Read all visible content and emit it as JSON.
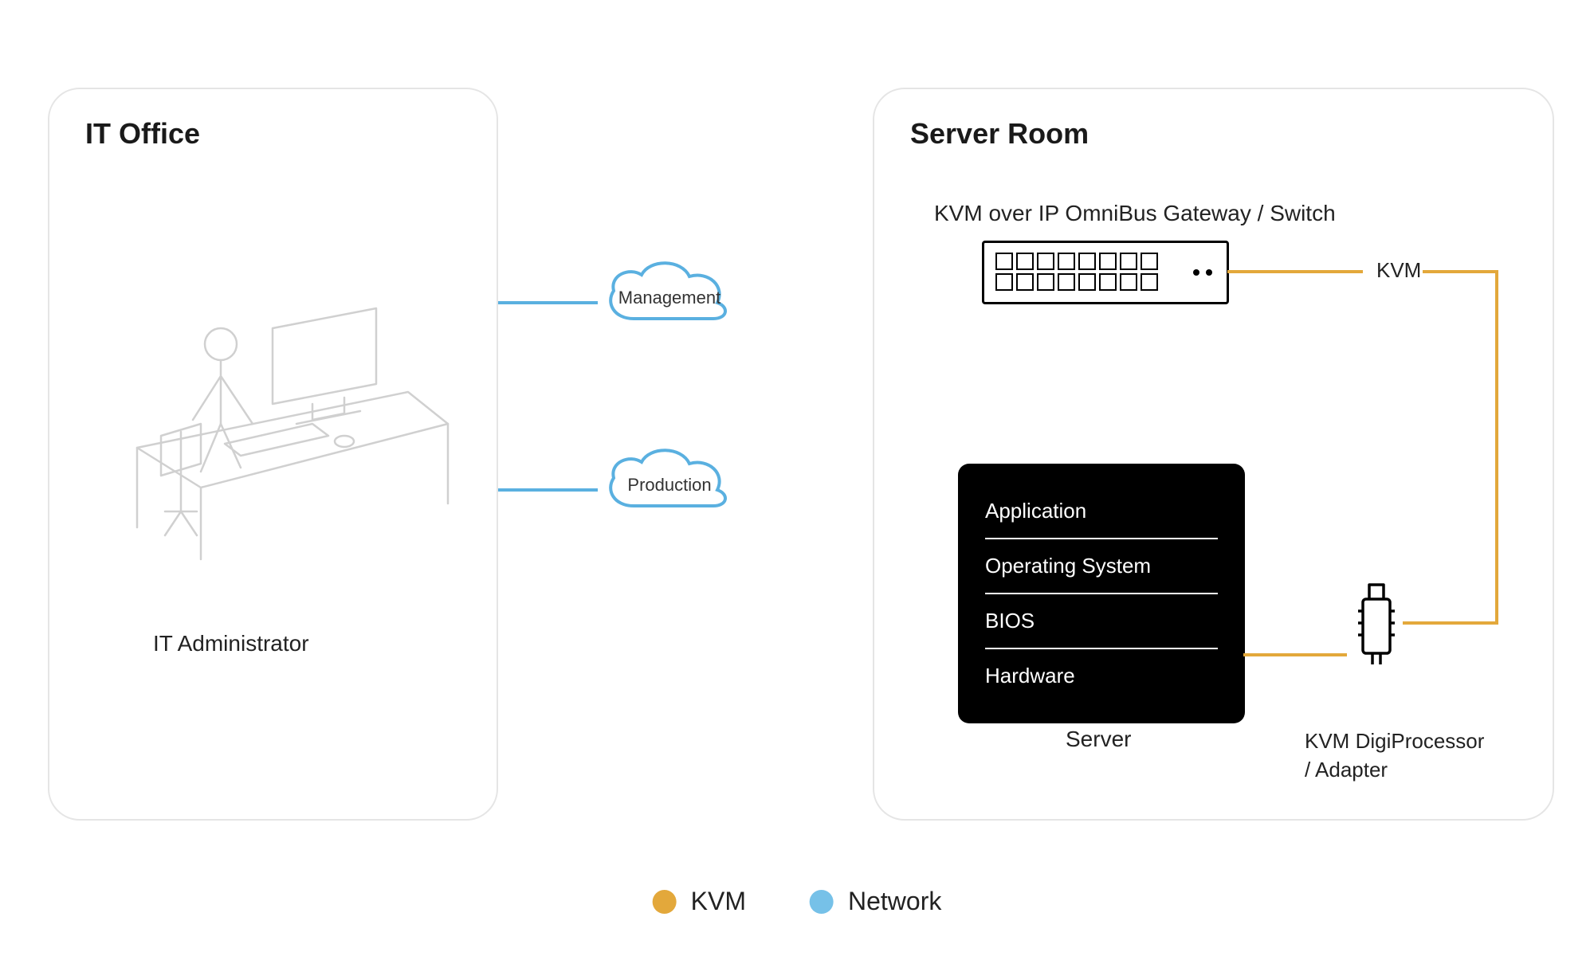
{
  "panels": {
    "left": {
      "title": "IT Office"
    },
    "right": {
      "title": "Server Room"
    }
  },
  "it_admin_label": "IT Administrator",
  "clouds": {
    "management": "Management",
    "production": "Production"
  },
  "switch": {
    "title": "KVM over IP OmniBus Gateway / Switch",
    "kvm_label": "KVM"
  },
  "server": {
    "layers": [
      "Application",
      "Operating System",
      "BIOS",
      "Hardware"
    ],
    "label": "Server"
  },
  "adapter": {
    "label_line1": "KVM DigiProcessor",
    "label_line2": "/ Adapter"
  },
  "legend": {
    "kvm": {
      "label": "KVM",
      "color": "#e3a83b"
    },
    "network": {
      "label": "Network",
      "color": "#76c1e8"
    }
  },
  "colors": {
    "blue": "#5ab0e0",
    "orange": "#e3a83b",
    "border": "#e5e5e5"
  }
}
